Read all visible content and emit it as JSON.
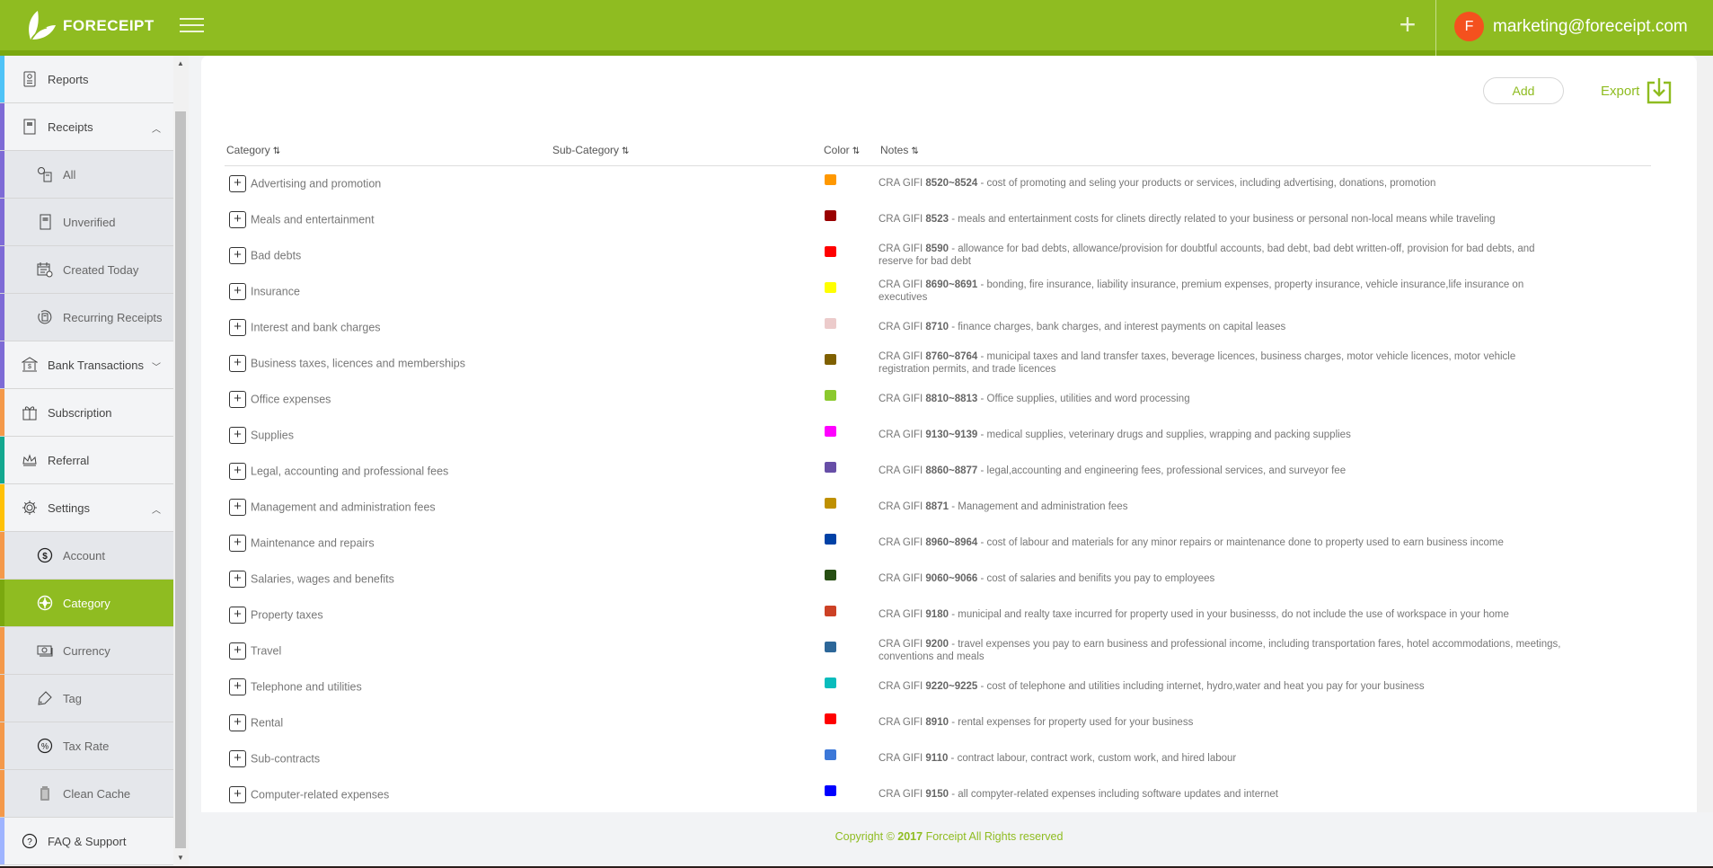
{
  "header": {
    "brand": "FORECEIPT",
    "avatar_initial": "F",
    "user_email": "marketing@foreceipt.com",
    "plus_icon": "+"
  },
  "sidebar": {
    "items": [
      {
        "label": "Reports",
        "icon": "report-icon",
        "stripe": "#4fc3f7",
        "type": "top"
      },
      {
        "label": "Receipts",
        "icon": "receipt-icon",
        "stripe": "#7e6bd6",
        "type": "top",
        "caret": "^"
      },
      {
        "label": "All",
        "icon": "all-receipts-icon",
        "stripe": "#7e6bd6",
        "type": "sub"
      },
      {
        "label": "Unverified",
        "icon": "unverified-icon",
        "stripe": "#7e6bd6",
        "type": "sub"
      },
      {
        "label": "Created Today",
        "icon": "calendar-icon",
        "stripe": "#7e6bd6",
        "type": "sub"
      },
      {
        "label": "Recurring Receipts",
        "icon": "recurring-icon",
        "stripe": "#7e6bd6",
        "type": "sub"
      },
      {
        "label": "Bank Transactions",
        "icon": "bank-icon",
        "stripe": "#7e6bd6",
        "type": "top",
        "caret": "v"
      },
      {
        "label": "Subscription",
        "icon": "gift-icon",
        "stripe": "#f4994a",
        "type": "top"
      },
      {
        "label": "Referral",
        "icon": "crown-icon",
        "stripe": "#13a88f",
        "type": "top"
      },
      {
        "label": "Settings",
        "icon": "gear-icon",
        "stripe": "#ffc107",
        "type": "top",
        "caret": "^"
      },
      {
        "label": "Account",
        "icon": "dollar-icon",
        "stripe": "#f4994a",
        "type": "sub"
      },
      {
        "label": "Category",
        "icon": "category-icon",
        "stripe": "#7aa80f",
        "type": "sub",
        "active": true
      },
      {
        "label": "Currency",
        "icon": "currency-icon",
        "stripe": "#f4994a",
        "type": "sub"
      },
      {
        "label": "Tag",
        "icon": "tag-icon",
        "stripe": "#f4994a",
        "type": "sub"
      },
      {
        "label": "Tax Rate",
        "icon": "percent-icon",
        "stripe": "#f4994a",
        "type": "sub"
      },
      {
        "label": "Clean Cache",
        "icon": "trash-icon",
        "stripe": "#f4994a",
        "type": "sub"
      },
      {
        "label": "FAQ & Support",
        "icon": "help-icon",
        "stripe": "#9fb4ff",
        "type": "top"
      }
    ]
  },
  "toolbar": {
    "add_label": "Add",
    "export_label": "Export"
  },
  "table": {
    "columns": [
      "Category",
      "Sub-Category",
      "Color",
      "Notes"
    ],
    "sort_glyph": "⇅",
    "rows": [
      {
        "category": "Advertising and promotion",
        "subcategory": "",
        "color": "#ff9800",
        "code": "8520~8524",
        "note": "cost of promoting and seling your products or services, including advertising, donations, promotion"
      },
      {
        "category": "Meals and entertainment",
        "subcategory": "",
        "color": "#990000",
        "code": "8523",
        "note": "meals and entertainment costs for clinets directly related to your business or personal non-local means while traveling"
      },
      {
        "category": "Bad debts",
        "subcategory": "",
        "color": "#ff0000",
        "code": "8590",
        "note": "allowance for bad debts, allowance/provision for doubtful accounts, bad debt, bad debt written-off, provision for bad debts, and reserve for bad debt"
      },
      {
        "category": "Insurance",
        "subcategory": "",
        "color": "#ffff00",
        "code": "8690~8691",
        "note": "bonding, fire insurance, liability insurance, premium expenses, property insurance, vehicle insurance,life insurance on executives"
      },
      {
        "category": "Interest and bank charges",
        "subcategory": "",
        "color": "#eccbcb",
        "code": "8710",
        "note": "finance charges, bank charges, and interest payments on capital leases"
      },
      {
        "category": "Business taxes, licences and memberships",
        "subcategory": "",
        "color": "#7f6000",
        "code": "8760~8764",
        "note": "municipal taxes and land transfer taxes, beverage licences, business charges, motor vehicle licences, motor vehicle registration permits, and trade licences"
      },
      {
        "category": "Office expenses",
        "subcategory": "",
        "color": "#8bc92e",
        "code": "8810~8813",
        "note": "Office supplies, utilities and word processing"
      },
      {
        "category": "Supplies",
        "subcategory": "",
        "color": "#ff00ff",
        "code": "9130~9139",
        "note": "medical supplies, veterinary drugs and supplies, wrapping and packing supplies"
      },
      {
        "category": "Legal, accounting and professional fees",
        "subcategory": "",
        "color": "#674ea7",
        "code": "8860~8877",
        "note": "legal,accounting and engineering fees, professional services, and surveyor fee"
      },
      {
        "category": "Management and administration fees",
        "subcategory": "",
        "color": "#bf9000",
        "code": "8871",
        "note": "Management and administration fees"
      },
      {
        "category": "Maintenance and repairs",
        "subcategory": "",
        "color": "#0041a6",
        "code": "8960~8964",
        "note": "cost of labour and materials for any minor repairs or maintenance done to property used to earn business income"
      },
      {
        "category": "Salaries, wages and benefits",
        "subcategory": "",
        "color": "#274e13",
        "code": "9060~9066",
        "note": "cost of salaries and benifits you pay to employees"
      },
      {
        "category": "Property taxes",
        "subcategory": "",
        "color": "#cc4125",
        "code": "9180",
        "note": "municipal and realty taxe incurred for property used in your businesss, do not include the use of workspace in your home"
      },
      {
        "category": "Travel",
        "subcategory": "",
        "color": "#2d6799",
        "code": "9200",
        "note": "travel expenses you pay to earn business and professional income, including transportation fares, hotel accommodations, meetings, conventions and meals"
      },
      {
        "category": "Telephone and utilities",
        "subcategory": "",
        "color": "#09bcbc",
        "code": "9220~9225",
        "note": "cost of telephone and utilities including internet, hydro,water and heat you pay for your business"
      },
      {
        "category": "Rental",
        "subcategory": "",
        "color": "#ff0000",
        "code": "8910",
        "note": "rental expenses for property used for your business"
      },
      {
        "category": "Sub-contracts",
        "subcategory": "",
        "color": "#3c78d8",
        "code": "9110",
        "note": "contract labour, contract work, custom work, and hired labour"
      },
      {
        "category": "Computer-related expenses",
        "subcategory": "",
        "color": "#0000ff",
        "code": "9150",
        "note": "all compyter-related expenses including software updates and internet"
      }
    ],
    "note_prefix": "CRA GIFI"
  },
  "footer": {
    "copyright_prefix": "Copyright ©",
    "year": "2017",
    "copyright_suffix": "Forceipt All Rights reserved"
  },
  "colors": {
    "brand_green": "#8fbc21",
    "brand_dark_green": "#7aa80f",
    "avatar_orange": "#f4511e"
  }
}
